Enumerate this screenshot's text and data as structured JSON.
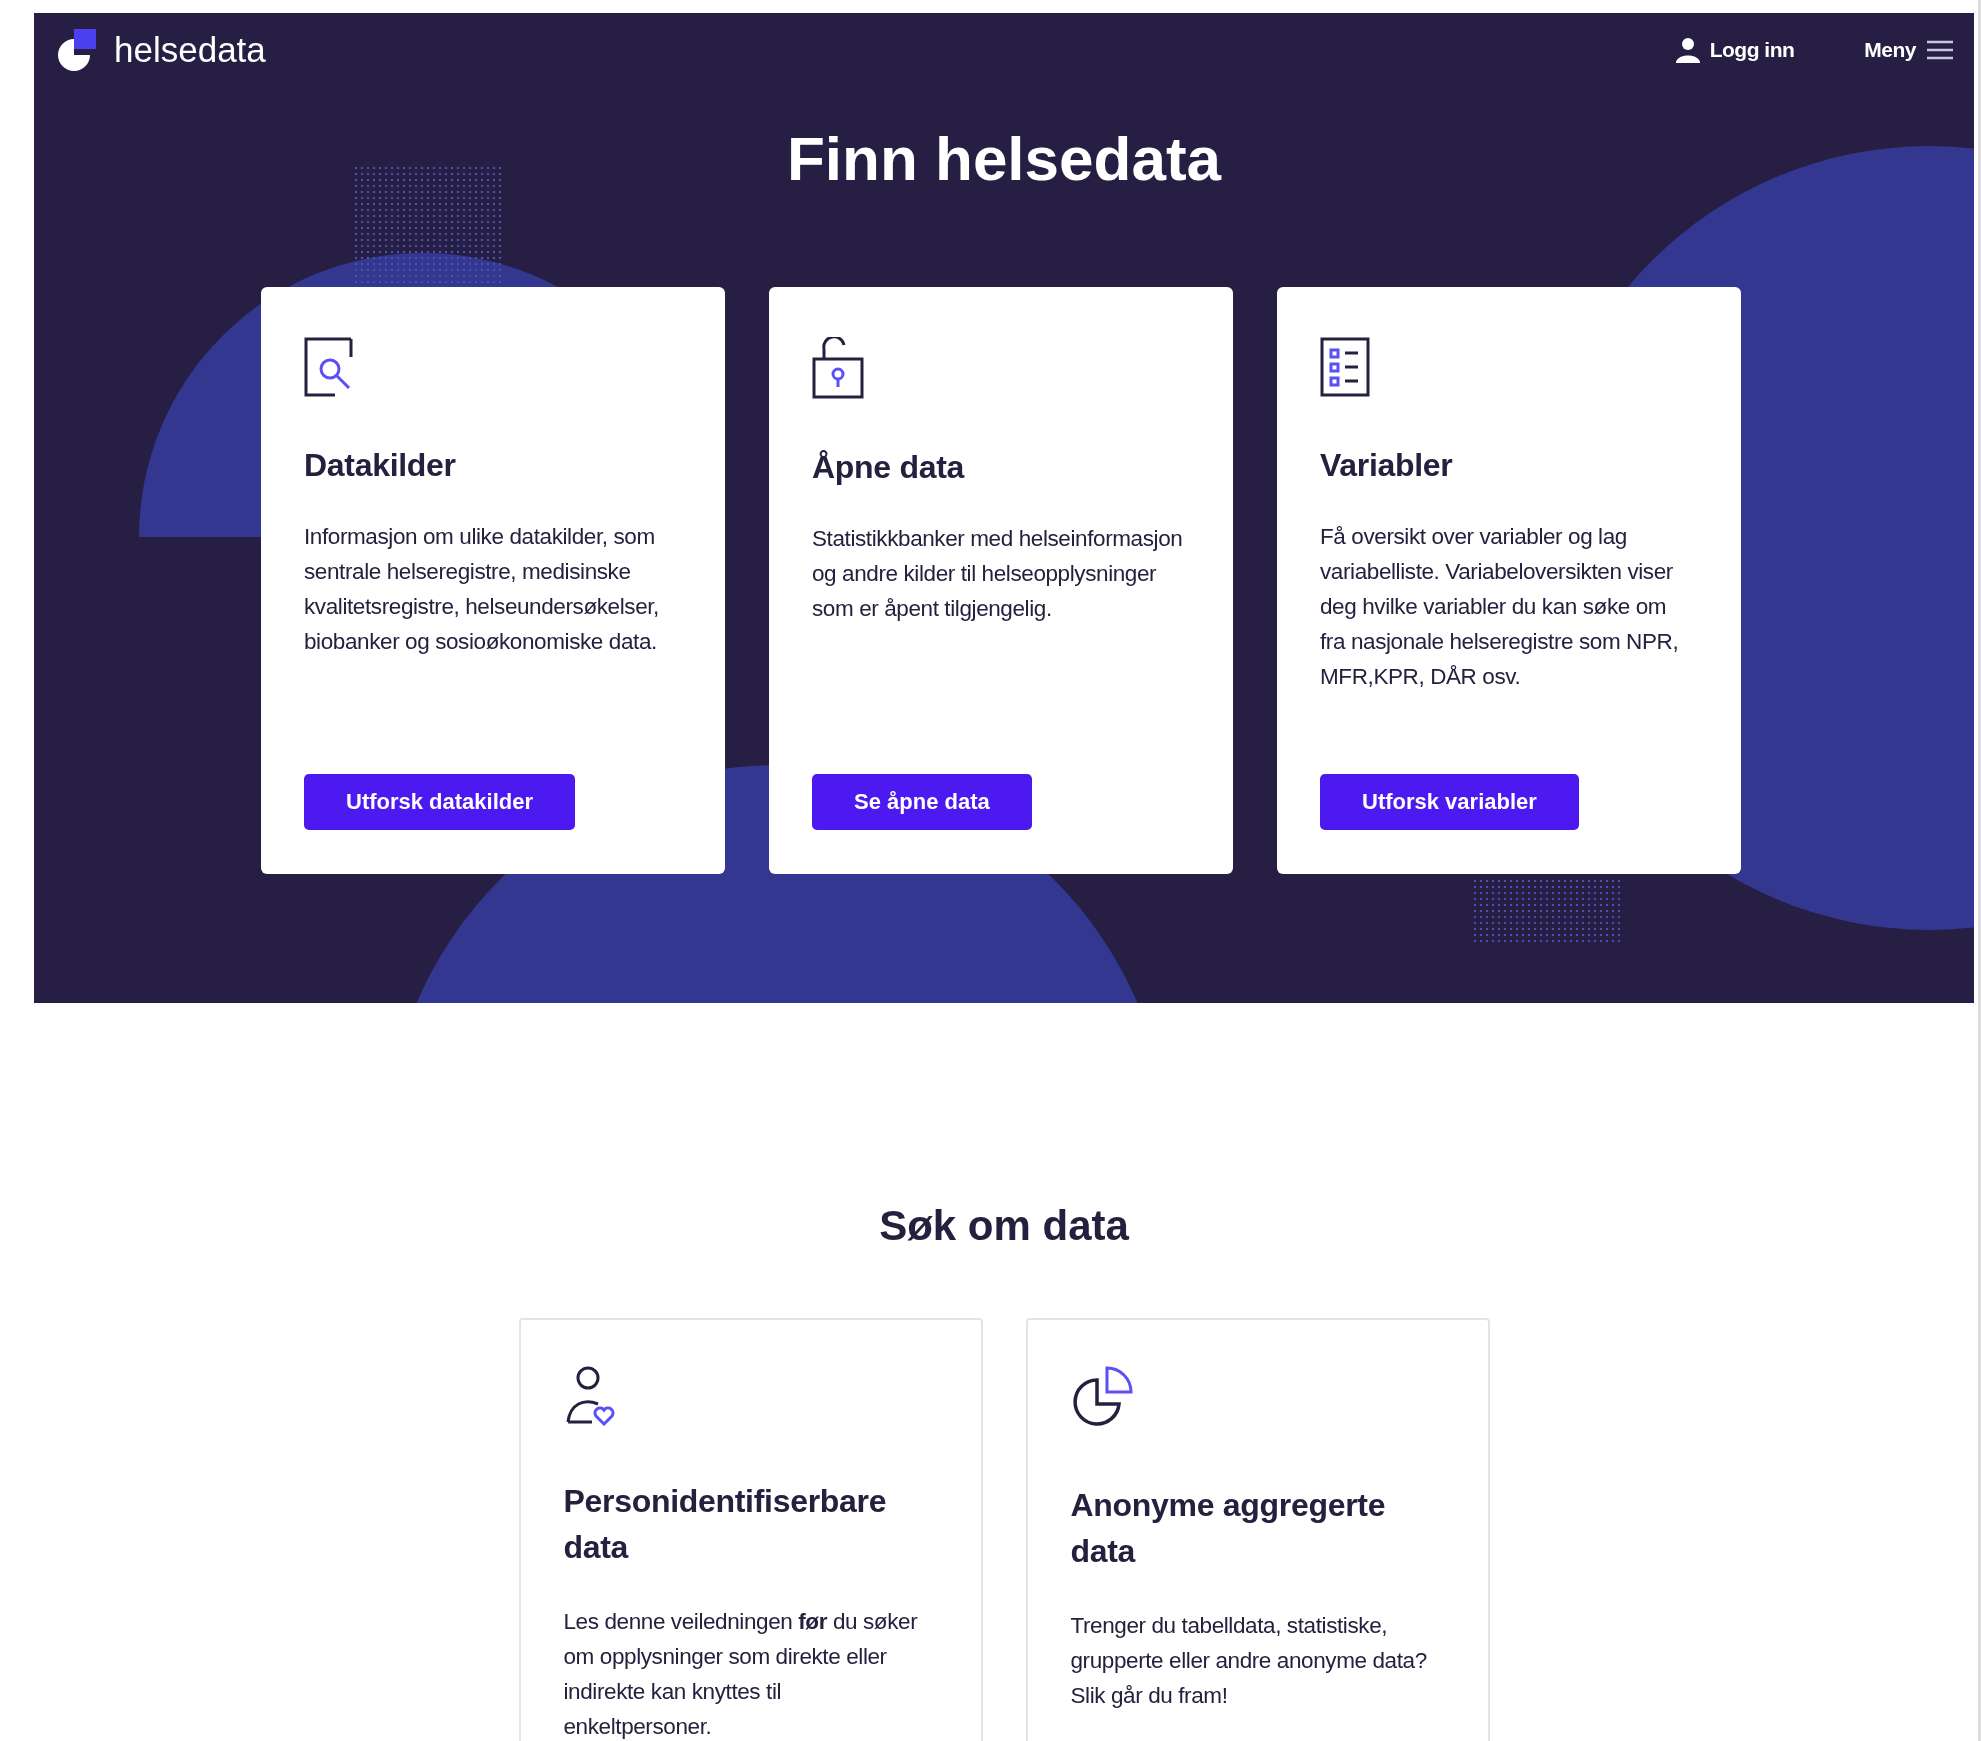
{
  "header": {
    "logo_text": "helsedata",
    "login": "Logg inn",
    "menu": "Meny"
  },
  "hero": {
    "title": "Finn helsedata",
    "cards": [
      {
        "title": "Datakilder",
        "text": "Informasjon om ulike datakilder, som sentrale helseregistre, medisinske kvalitetsregistre, helseundersøkelser, biobanker og sosioøkonomiske data.",
        "button": "Utforsk datakilder"
      },
      {
        "title": "Åpne data",
        "text": "Statistikkbanker med helseinformasjon og andre kilder til helseopplysninger som er åpent tilgjengelig.",
        "button": "Se åpne data"
      },
      {
        "title": "Variabler",
        "text": "Få oversikt over variabler og lag variabelliste. Variabeloversikten viser deg hvilke variabler du kan søke om fra nasjonale helseregistre som NPR, MFR,KPR, DÅR osv.",
        "button": "Utforsk variabler"
      }
    ]
  },
  "apply": {
    "title": "Søk om data",
    "cards": [
      {
        "title": "Personidentifiserbare data",
        "text": "Les denne veiledningen **før** du søker om opplysninger som direkte eller indirekte kan knyttes til enkeltpersoner."
      },
      {
        "title": "Anonyme aggregerte data",
        "text": "Trenger du tabelldata, statistiske, grupperte eller andre anonyme data? Slik går du fram!"
      }
    ]
  }
}
